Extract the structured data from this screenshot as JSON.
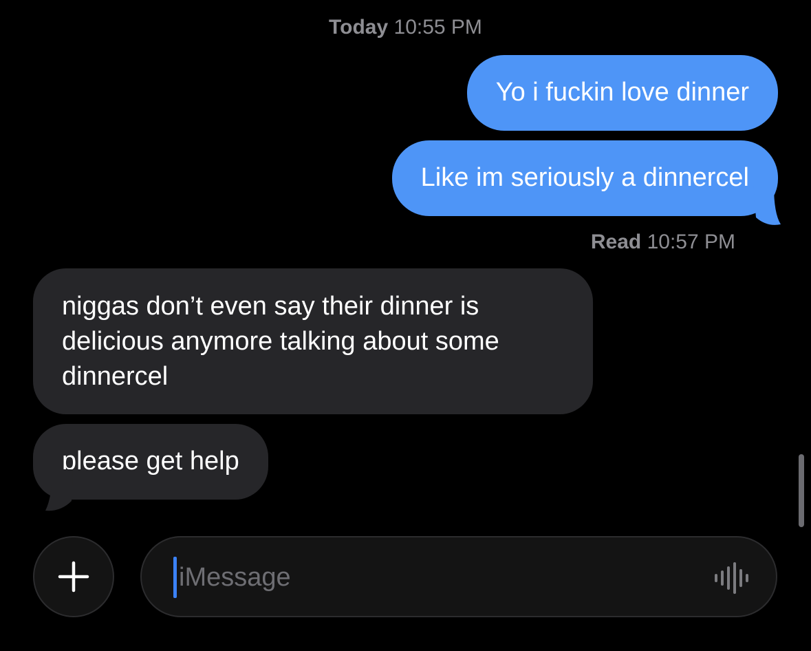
{
  "header": {
    "timestamp_day": "Today",
    "timestamp_time": "10:55 PM"
  },
  "messages": {
    "sent": [
      {
        "text": "Yo i fuckin love dinner"
      },
      {
        "text": "Like im seriously a dinnercel"
      }
    ],
    "read_receipt": {
      "label": "Read",
      "time": "10:57 PM"
    },
    "received": [
      {
        "text": "niggas don’t even say their dinner is delicious anymore talking about some dinnercel"
      },
      {
        "text": "please get help"
      }
    ]
  },
  "composer": {
    "placeholder": "iMessage",
    "plus_icon": "plus-icon",
    "audio_icon": "waveform-icon"
  },
  "colors": {
    "sent_bubble": "#4e95f7",
    "received_bubble": "#262629",
    "background": "#000000",
    "meta_text": "#8e8e93",
    "caret": "#3b82f6"
  }
}
